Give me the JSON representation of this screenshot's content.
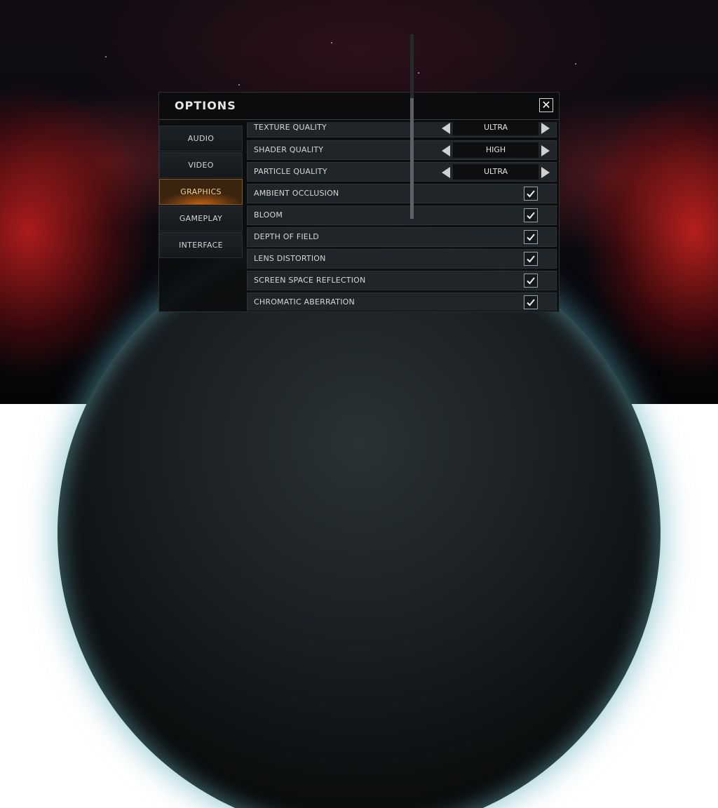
{
  "dialog": {
    "title": "OPTIONS",
    "close_symbol": "✕"
  },
  "tabs": [
    {
      "label": "AUDIO",
      "active": false
    },
    {
      "label": "VIDEO",
      "active": false
    },
    {
      "label": "GRAPHICS",
      "active": true
    },
    {
      "label": "GAMEPLAY",
      "active": false
    },
    {
      "label": "INTERFACE",
      "active": false
    }
  ],
  "settings": {
    "texture_quality": {
      "label": "TEXTURE QUALITY",
      "value": "ULTRA"
    },
    "shader_quality": {
      "label": "SHADER QUALITY",
      "value": "HIGH"
    },
    "particle_quality": {
      "label": "PARTICLE QUALITY",
      "value": "ULTRA"
    },
    "ambient_occlusion": {
      "label": "AMBIENT OCCLUSION",
      "checked": true
    },
    "bloom": {
      "label": "BLOOM",
      "checked": true
    },
    "depth_of_field": {
      "label": "DEPTH OF FIELD",
      "checked": true
    },
    "lens_distortion": {
      "label": "LENS DISTORTION",
      "checked": true
    },
    "screen_space_reflection": {
      "label": "SCREEN SPACE REFLECTION",
      "checked": true
    },
    "chromatic_aberration": {
      "label": "CHROMATIC ABERRATION",
      "checked": true
    }
  },
  "colors": {
    "accent_active_tab": "#c06010",
    "panel_bg": "#202529"
  },
  "icons": {
    "close": "close-icon",
    "left": "arrow-left-icon",
    "right": "arrow-right-icon",
    "check": "checkmark-icon"
  }
}
